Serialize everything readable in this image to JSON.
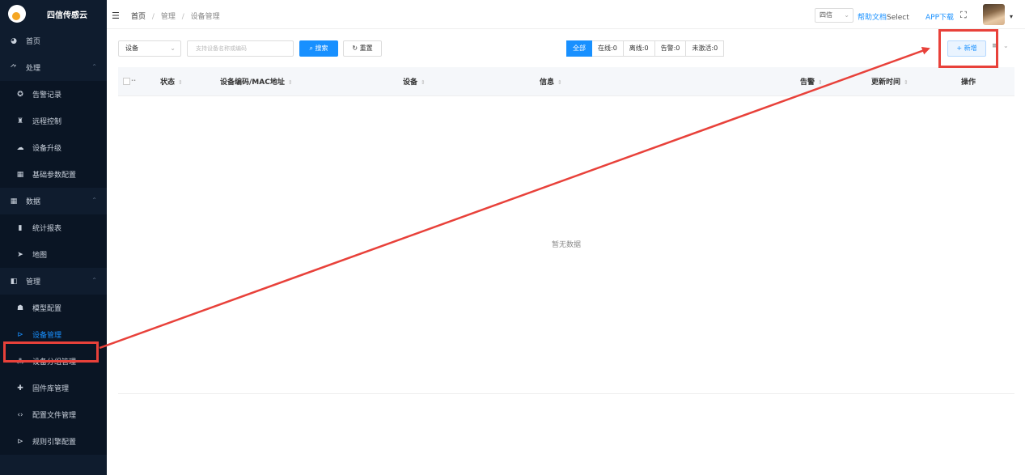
{
  "app": {
    "logo_text": "四信传感云"
  },
  "sidebar": {
    "items": [
      {
        "type": "item",
        "icon": "dashboard-icon",
        "glyph": "◕",
        "label": "首页"
      },
      {
        "type": "group",
        "icon": "process-icon",
        "glyph": "⺈",
        "label": "处理",
        "caret": "⌃"
      },
      {
        "type": "sub",
        "icon": "alarm-icon",
        "glyph": "✪",
        "label": "告警记录"
      },
      {
        "type": "sub",
        "icon": "remote-icon",
        "glyph": "♜",
        "label": "远程控制"
      },
      {
        "type": "sub",
        "icon": "cloud-upgrade-icon",
        "glyph": "☁",
        "label": "设备升级"
      },
      {
        "type": "sub",
        "icon": "table-icon",
        "glyph": "▦",
        "label": "基础参数配置"
      },
      {
        "type": "group",
        "icon": "data-icon",
        "glyph": "▦",
        "label": "数据",
        "caret": "⌃"
      },
      {
        "type": "sub",
        "icon": "chart-icon",
        "glyph": "▮",
        "label": "统计报表"
      },
      {
        "type": "sub",
        "icon": "map-icon",
        "glyph": "➤",
        "label": "地图"
      },
      {
        "type": "group",
        "icon": "manage-icon",
        "glyph": "◧",
        "label": "管理",
        "caret": "⌃"
      },
      {
        "type": "sub",
        "icon": "model-icon",
        "glyph": "☗",
        "label": "模型配置"
      },
      {
        "type": "sub",
        "icon": "device-icon",
        "glyph": "⊳",
        "label": "设备管理",
        "active": true
      },
      {
        "type": "sub",
        "icon": "group-icon",
        "glyph": "⁂",
        "label": "设备分组管理"
      },
      {
        "type": "sub",
        "icon": "firmware-icon",
        "glyph": "✚",
        "label": "固件库管理"
      },
      {
        "type": "sub",
        "icon": "code-icon",
        "glyph": "‹›",
        "label": "配置文件管理"
      },
      {
        "type": "sub",
        "icon": "rule-icon",
        "glyph": "⊳",
        "label": "规则引擎配置"
      }
    ]
  },
  "header": {
    "breadcrumb": [
      "首页",
      "管理",
      "设备管理"
    ],
    "separator": "/",
    "lang": "四信",
    "help_link": "帮助文档",
    "help_select": "Select",
    "app_download": "APP下载"
  },
  "toolbar": {
    "select_value": "设备",
    "search_placeholder": "支持设备名称或编码",
    "search_button": "搜索",
    "reset_button": "重置",
    "filters": [
      "全部",
      "在线:0",
      "离线:0",
      "告警:0",
      "未激活:0"
    ],
    "active_filter": 0,
    "add_button": "+ 新增"
  },
  "table": {
    "columns": [
      "状态",
      "设备编码/MAC地址",
      "设备",
      "信息",
      "告警",
      "更新时间",
      "操作"
    ],
    "empty_text": "暂无数据"
  },
  "colors": {
    "sidebar_bg": "#0f1c2e",
    "accent": "#1890ff",
    "annotation": "#e8413a"
  }
}
